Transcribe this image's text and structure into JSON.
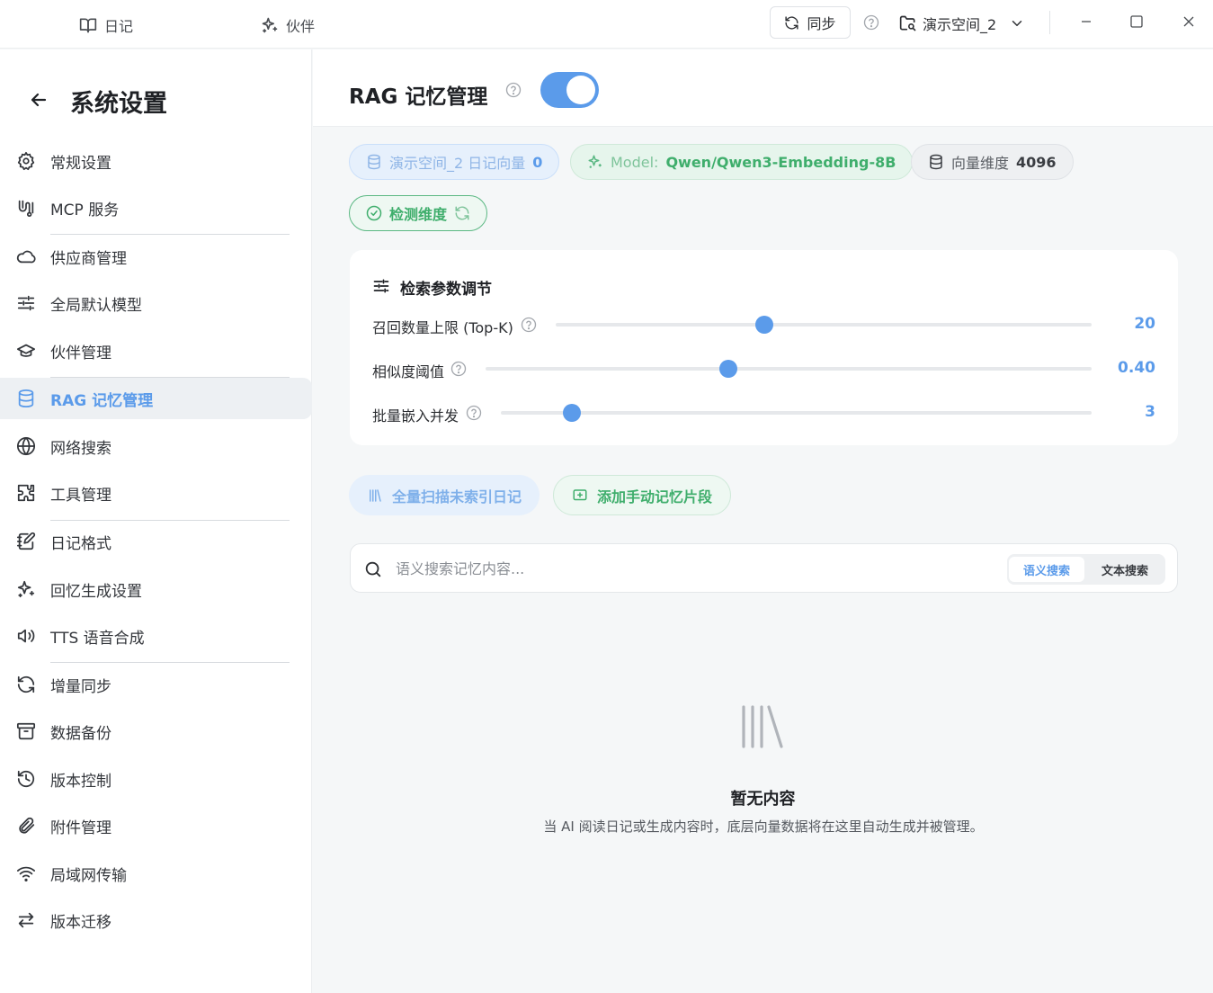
{
  "titlebar": {
    "tab_diary": "日记",
    "tab_partner": "伙伴",
    "sync_label": "同步",
    "workspace_label": "演示空间_2"
  },
  "sidebar": {
    "title": "系统设置",
    "items": [
      {
        "label": "常规设置",
        "icon": "gear-icon"
      },
      {
        "label": "MCP 服务",
        "icon": "mcp-icon"
      },
      {
        "label": "供应商管理",
        "icon": "cloud-icon"
      },
      {
        "label": "全局默认模型",
        "icon": "sliders-icon"
      },
      {
        "label": "伙伴管理",
        "icon": "graduation-cap-icon"
      },
      {
        "label": "RAG 记忆管理",
        "icon": "database-icon"
      },
      {
        "label": "网络搜索",
        "icon": "globe-icon"
      },
      {
        "label": "工具管理",
        "icon": "puzzle-icon"
      },
      {
        "label": "日记格式",
        "icon": "notebook-pen-icon"
      },
      {
        "label": "回忆生成设置",
        "icon": "sparkles-icon"
      },
      {
        "label": "TTS 语音合成",
        "icon": "speaker-icon"
      },
      {
        "label": "增量同步",
        "icon": "refresh-icon"
      },
      {
        "label": "数据备份",
        "icon": "archive-icon"
      },
      {
        "label": "版本控制",
        "icon": "history-icon"
      },
      {
        "label": "附件管理",
        "icon": "paperclip-icon"
      },
      {
        "label": "局域网传输",
        "icon": "wifi-icon"
      },
      {
        "label": "版本迁移",
        "icon": "arrows-swap-icon"
      }
    ],
    "active_index": 5
  },
  "main": {
    "title": "RAG 记忆管理",
    "enabled": true,
    "chips": {
      "space_label": "演示空间_2 日记向量",
      "space_count": "0",
      "model_prefix": "Model:",
      "model_name": "Qwen/Qwen3-Embedding-8B",
      "dim_label": "向量维度",
      "dim_value": "4096",
      "detect_label": "检测维度"
    },
    "params": {
      "title": "检索参数调节",
      "items": [
        {
          "label": "召回数量上限 (Top-K)",
          "value": "20",
          "level": 0.39
        },
        {
          "label": "相似度阈值",
          "value": "0.40",
          "level": 0.4
        },
        {
          "label": "批量嵌入并发",
          "value": "3",
          "level": 0.12
        }
      ]
    },
    "actions": {
      "scan_label": "全量扫描未索引日记",
      "add_label": "添加手动记忆片段"
    },
    "search": {
      "placeholder": "语义搜索记忆内容...",
      "value": "",
      "mode_semantic": "语义搜索",
      "mode_text": "文本搜索"
    },
    "empty": {
      "title": "暂无内容",
      "description": "当 AI 阅读日记或生成内容时，底层向量数据将在这里自动生成并被管理。"
    }
  },
  "colors": {
    "accent": "#5b9bea",
    "green": "#3fae6c"
  }
}
